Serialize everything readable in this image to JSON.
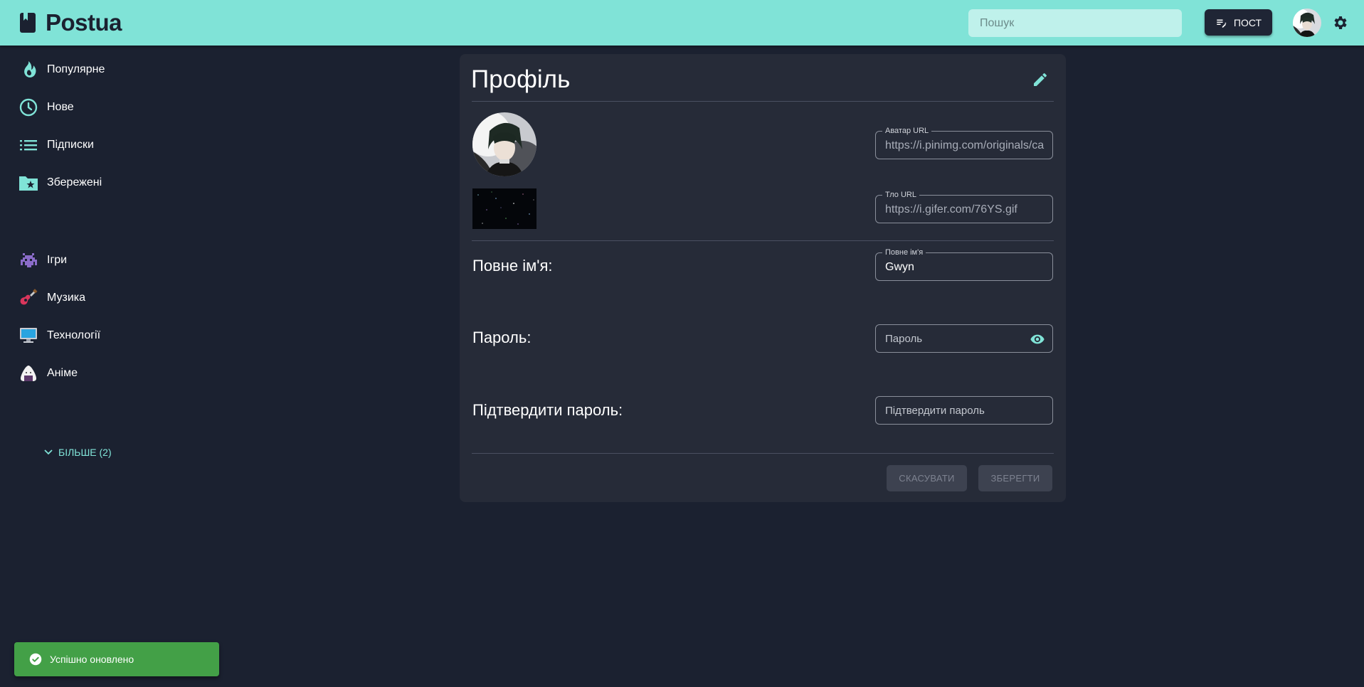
{
  "header": {
    "brand": "Postua",
    "search_placeholder": "Пошук",
    "post_label": "ПОСТ"
  },
  "sidebar": {
    "items": [
      {
        "label": "Популярне",
        "icon": "flame-icon"
      },
      {
        "label": "Нове",
        "icon": "clock-icon"
      },
      {
        "label": "Підписки",
        "icon": "list-icon"
      },
      {
        "label": "Збережені",
        "icon": "star-folder-icon"
      },
      {
        "label": "Ігри",
        "icon": "space-invader-icon"
      },
      {
        "label": "Музика",
        "icon": "guitar-icon"
      },
      {
        "label": "Технології",
        "icon": "computer-icon"
      },
      {
        "label": "Аніме",
        "icon": "onigiri-icon"
      }
    ],
    "more_label": "БІЛЬШЕ (2)"
  },
  "profile": {
    "title": "Профіль",
    "avatar_url_label": "Аватар URL",
    "avatar_url_value": "https://i.pinimg.com/originals/ca",
    "bg_url_label": "Тло URL",
    "bg_url_value": "https://i.gifer.com/76YS.gif",
    "fullname_row_label": "Повне ім'я:",
    "fullname_field_label": "Повне ім'я",
    "fullname_value": "Gwyn",
    "password_row_label": "Пароль:",
    "password_placeholder": "Пароль",
    "confirm_row_label": "Підтвердити пароль:",
    "confirm_placeholder": "Підтвердити пароль",
    "cancel_label": "СКАСУВАТИ",
    "save_label": "ЗБЕРЕГТИ"
  },
  "toast": {
    "message": "Успішно оновлено"
  },
  "colors": {
    "accent": "#80e3d7",
    "background": "#1b2130",
    "card": "#262b38",
    "toast": "#43a047"
  }
}
